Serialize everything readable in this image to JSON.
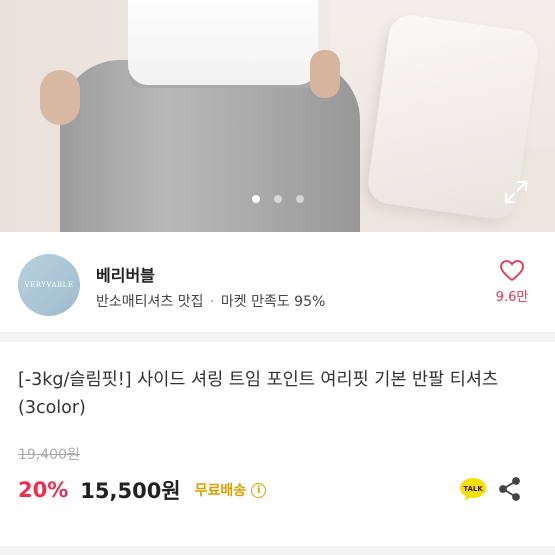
{
  "gallery": {
    "dots": 3,
    "active_index": 0
  },
  "shop": {
    "logo_text": "VERYVABLE",
    "name": "베리버블",
    "category": "반소매티셔츠 맛집",
    "separator": "·",
    "satisfaction": "마켓 만족도 95%",
    "likes": "9.6만"
  },
  "product": {
    "title": "[-3kg/슬림핏!] 사이드 셔링 트임 포인트 여리핏 기본 반팔 티셔츠 (3color)",
    "original_price": "19,400원",
    "discount": "20%",
    "price": "15,500원",
    "shipping": "무료배송",
    "info_icon": "i"
  },
  "colors": {
    "accent": "#ef2d4e",
    "shipping": "#d6a100",
    "kakao": "#f9e000"
  },
  "icons": [
    "expand-icon",
    "heart-icon",
    "info-icon",
    "kakaotalk-icon",
    "share-icon"
  ]
}
